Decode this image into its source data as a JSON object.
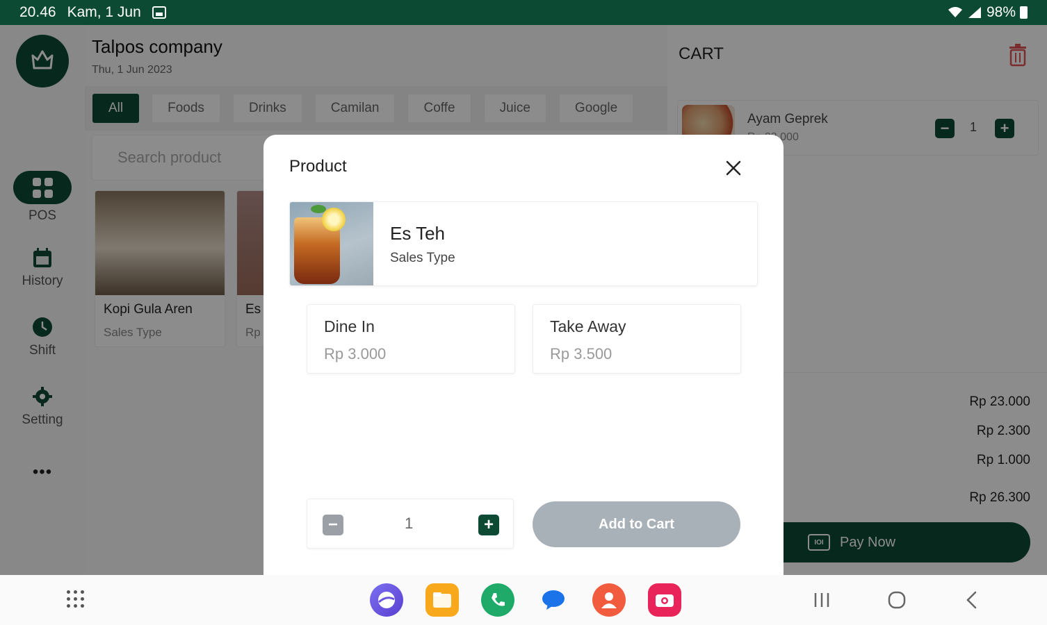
{
  "status_bar": {
    "time": "20.46",
    "date": "Kam, 1 Jun",
    "battery": "98%"
  },
  "sidebar": {
    "items": [
      {
        "label": "POS"
      },
      {
        "label": "History"
      },
      {
        "label": "Shift"
      },
      {
        "label": "Setting"
      }
    ],
    "more": "•••"
  },
  "header": {
    "company": "Talpos company",
    "date": "Thu, 1 Jun 2023"
  },
  "categories": [
    "All",
    "Foods",
    "Drinks",
    "Camilan",
    "Coffe",
    "Juice",
    "Google"
  ],
  "search": {
    "placeholder": "Search product"
  },
  "products": [
    {
      "name": "Kopi Gula Aren",
      "subtitle": "Sales Type"
    },
    {
      "name": "Es",
      "subtitle": "Rp"
    }
  ],
  "cart": {
    "title": "CART",
    "item": {
      "name": "Ayam Geprek",
      "price": "Rp 23.000",
      "qty": "1"
    },
    "summary": [
      "Rp 23.000",
      "Rp 2.300",
      "Rp 1.000",
      "Rp 26.300"
    ],
    "pay_label": "Pay Now"
  },
  "modal": {
    "title": "Product",
    "product_name": "Es Teh",
    "product_type": "Sales Type",
    "options": [
      {
        "name": "Dine In",
        "price": "Rp 3.000"
      },
      {
        "name": "Take Away",
        "price": "Rp 3.500"
      }
    ],
    "qty": "1",
    "add_label": "Add to Cart"
  },
  "colors": {
    "primary": "#0d4a33",
    "disabled_button": "#a9b1b8"
  },
  "dock_apps": [
    "internet-icon",
    "files-icon",
    "phone-icon",
    "messages-icon",
    "contacts-icon",
    "camera-icon"
  ]
}
